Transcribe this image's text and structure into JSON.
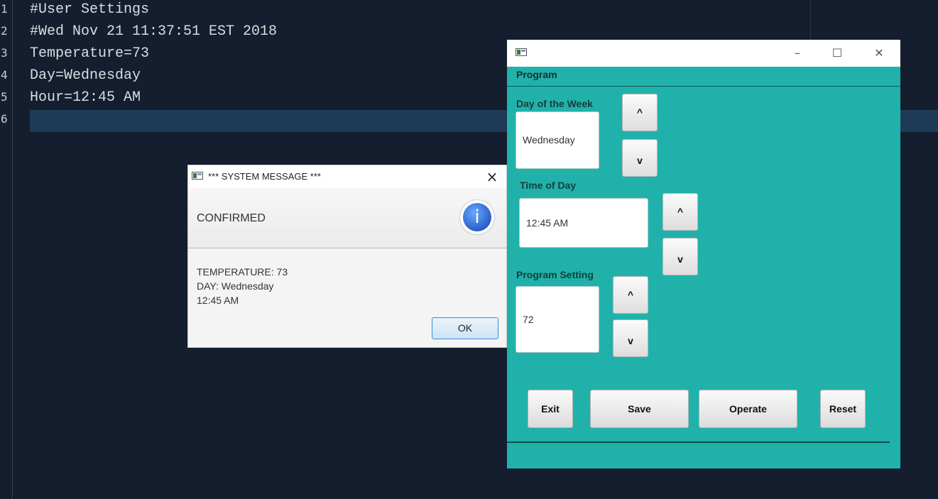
{
  "editor": {
    "lines": [
      {
        "num": "1",
        "text": "#User Settings"
      },
      {
        "num": "2",
        "text": "#Wed Nov 21 11:37:51 EST 2018"
      },
      {
        "num": "3",
        "text": "Temperature=73"
      },
      {
        "num": "4",
        "text": "Day=Wednesday"
      },
      {
        "num": "5",
        "text": "Hour=12:45 AM"
      },
      {
        "num": "6",
        "text": ""
      }
    ]
  },
  "dialog": {
    "title": "*** SYSTEM MESSAGE ***",
    "close_icon": "×",
    "header": "CONFIRMED",
    "info_icon": "i",
    "content": [
      "TEMPERATURE: 73",
      "DAY: Wednesday",
      "12:45 AM"
    ],
    "ok_label": "OK"
  },
  "program_window": {
    "minimize": "–",
    "maximize": "☐",
    "close": "✕",
    "menu": "Program",
    "day": {
      "label": "Day of the Week",
      "value": "Wednesday"
    },
    "time": {
      "label": "Time of Day",
      "value": "12:45 AM"
    },
    "setting": {
      "label": "Program Setting",
      "value": "72"
    },
    "up_label": "^",
    "down_label": "v",
    "buttons": {
      "exit": "Exit",
      "save": "Save",
      "operate": "Operate",
      "reset": "Reset"
    }
  },
  "colors": {
    "editor_bg": "#141e2e",
    "program_bg": "#20b2aa",
    "current_line": "#1f3a57"
  }
}
